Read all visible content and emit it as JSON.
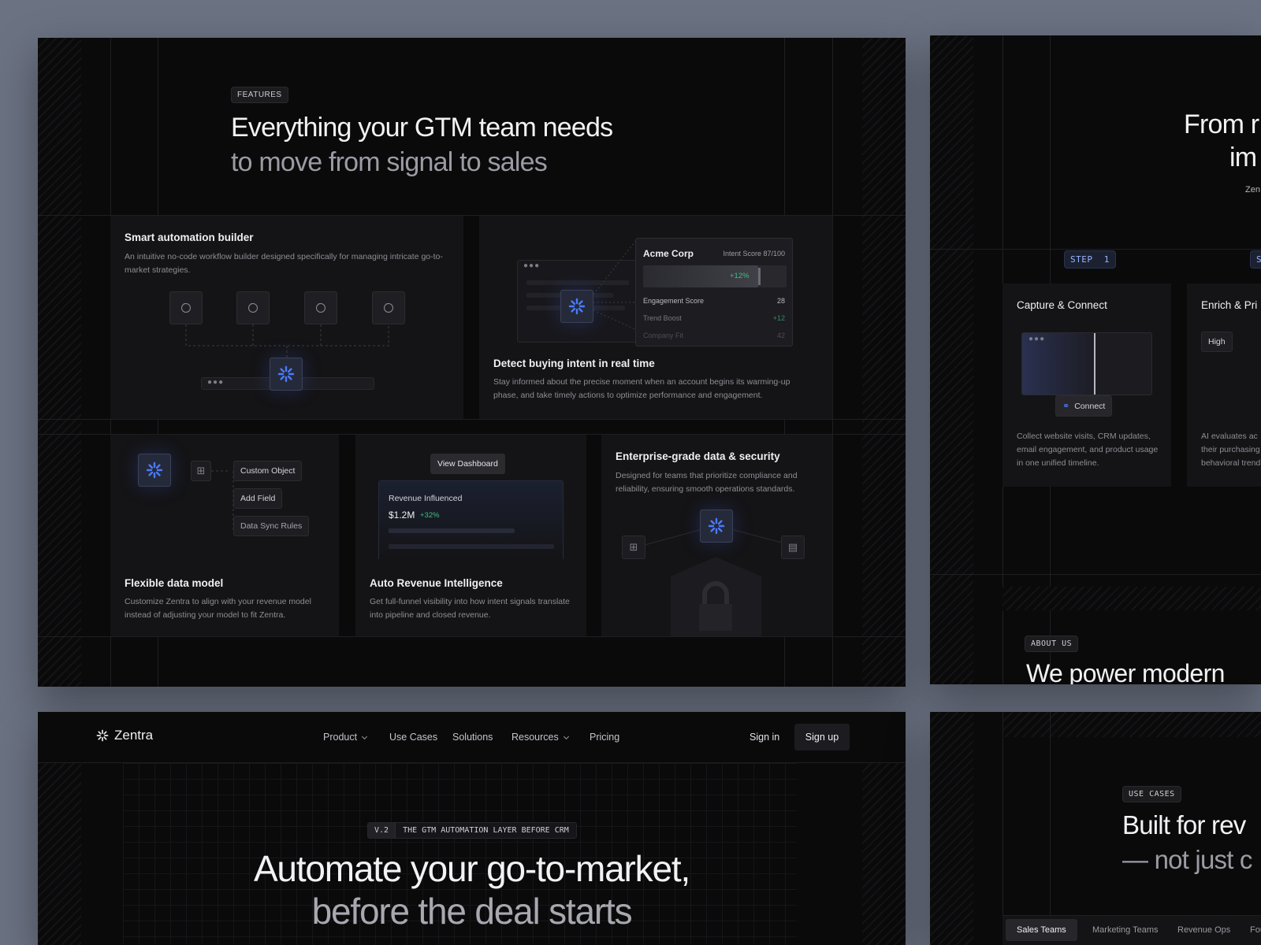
{
  "features": {
    "badge": "FEATURES",
    "heading_line1": "Everything your GTM team needs",
    "heading_line2": "to move from signal to sales",
    "automation": {
      "title": "Smart automation builder",
      "desc": "An intuitive no-code workflow builder designed specifically for managing intricate go-to-market strategies."
    },
    "intent": {
      "company": "Acme Corp",
      "score": "Intent Score 87/100",
      "delta": "+12%",
      "rows": [
        {
          "label": "Engagement Score",
          "value": "28"
        },
        {
          "label": "Trend Boost",
          "value": "+12"
        },
        {
          "label": "Company Fit",
          "value": "42"
        }
      ],
      "title": "Detect buying intent in real time",
      "desc": "Stay informed about the precise moment when an account begins its warming-up phase, and take timely actions to optimize performance and engagement."
    },
    "data_model": {
      "pills": [
        "Custom Object",
        "Add Field",
        "Data Sync Rules"
      ],
      "title": "Flexible data model",
      "desc": "Customize Zentra to align with your revenue model instead of adjusting your model to fit Zentra."
    },
    "revenue": {
      "button": "View Dashboard",
      "card_label": "Revenue Influenced",
      "amount": "$1.2M",
      "delta": "+32%",
      "title": "Auto Revenue Intelligence",
      "desc": "Get full-funnel visibility into how intent signals translate into pipeline and closed revenue."
    },
    "security": {
      "title": "Enterprise-grade data & security",
      "desc": "Designed for teams that prioritize compliance and reliability, ensuring smooth operations standards."
    }
  },
  "steps": {
    "heading_line1": "From r",
    "heading_line2": "im",
    "sub": "Zen",
    "step1": "STEP  1",
    "step2": "S",
    "capture": {
      "title": "Capture & Connect",
      "button": "Connect",
      "desc": "Collect website visits, CRM updates, email engagement, and product usage in one unified timeline."
    },
    "enrich": {
      "title": "Enrich & Pri",
      "tag": "High",
      "desc": "AI evaluates ac their purchasing behavioral trend"
    },
    "about_badge": "ABOUT US",
    "about_heading": "We power modern"
  },
  "hero": {
    "brand": "Zentra",
    "nav": [
      "Product",
      "Use Cases",
      "Solutions",
      "Resources",
      "Pricing"
    ],
    "signin": "Sign in",
    "signup": "Sign up",
    "version": "V.2",
    "tagline": "THE GTM AUTOMATION LAYER BEFORE CRM",
    "heading_line1": "Automate your go-to-market,",
    "heading_line2": "before the deal starts"
  },
  "usecases": {
    "badge": "USE CASES",
    "heading_line1": "Built for rev",
    "heading_line2": "— not just c",
    "tabs": [
      "Sales Teams",
      "Marketing Teams",
      "Revenue Ops",
      "Fou"
    ]
  },
  "colors": {
    "accent_blue": "#4a7bff",
    "positive_green": "#3fbf7f"
  }
}
